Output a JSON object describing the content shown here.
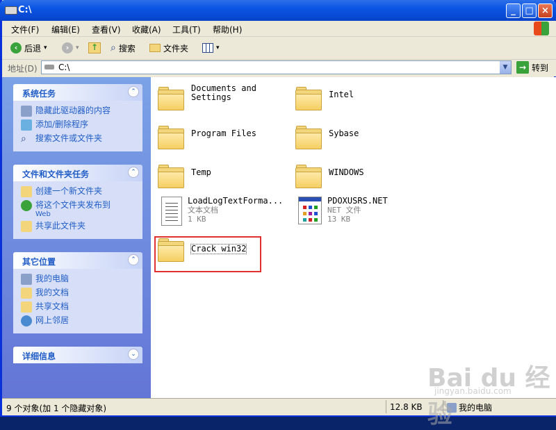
{
  "window": {
    "title": "C:\\",
    "controls": {
      "minimize": "_",
      "maximize": "□",
      "close": "×"
    }
  },
  "menubar": {
    "items": [
      "文件(F)",
      "编辑(E)",
      "查看(V)",
      "收藏(A)",
      "工具(T)",
      "帮助(H)"
    ]
  },
  "toolbar": {
    "back": "后退",
    "back_dropdown": "▾",
    "forward_dropdown": "▾",
    "search": "搜索",
    "folders": "文件夹",
    "views_dropdown": "▾"
  },
  "address": {
    "label": "地址(D)",
    "value": "C:\\",
    "go": "转到"
  },
  "sidebar": {
    "system_tasks": {
      "title": "系统任务",
      "chevron": "⌃",
      "items": [
        "隐藏此驱动器的内容",
        "添加/删除程序",
        "搜索文件或文件夹"
      ]
    },
    "file_tasks": {
      "title": "文件和文件夹任务",
      "chevron": "⌃",
      "items": [
        "创建一个新文件夹",
        "将这个文件夹发布到",
        "共享此文件夹"
      ],
      "publish_sub": "Web"
    },
    "other_places": {
      "title": "其它位置",
      "chevron": "⌃",
      "items": [
        "我的电脑",
        "我的文档",
        "共享文档",
        "网上邻居"
      ]
    },
    "details": {
      "title": "详细信息",
      "chevron": "⌄"
    }
  },
  "files": [
    {
      "name": "Documents and",
      "name2": "Settings",
      "type": "folder"
    },
    {
      "name": "Intel",
      "type": "folder"
    },
    {
      "name": "Program Files",
      "type": "folder"
    },
    {
      "name": "Sybase",
      "type": "folder"
    },
    {
      "name": "Temp",
      "type": "folder"
    },
    {
      "name": "WINDOWS",
      "type": "folder"
    },
    {
      "name": "LoadLogTextForma...",
      "kind": "文本文档",
      "size": "1 KB",
      "type": "text"
    },
    {
      "name": "PDOXUSRS.NET",
      "kind": "NET 文件",
      "size": "13 KB",
      "type": "net"
    },
    {
      "name": "Crack win32",
      "type": "folder"
    }
  ],
  "status": {
    "objects": "9 个对象(加 1 个隐藏对象)",
    "size": "12.8 KB",
    "location": "我的电脑"
  },
  "watermark": {
    "main": "Bai du 经验",
    "sub": "jingyan.baidu.com"
  },
  "colors": {
    "title_blue": "#0a55e4",
    "link_blue": "#215dc6",
    "highlight_red": "#e03030",
    "folder_yellow": "#f5cf62"
  }
}
